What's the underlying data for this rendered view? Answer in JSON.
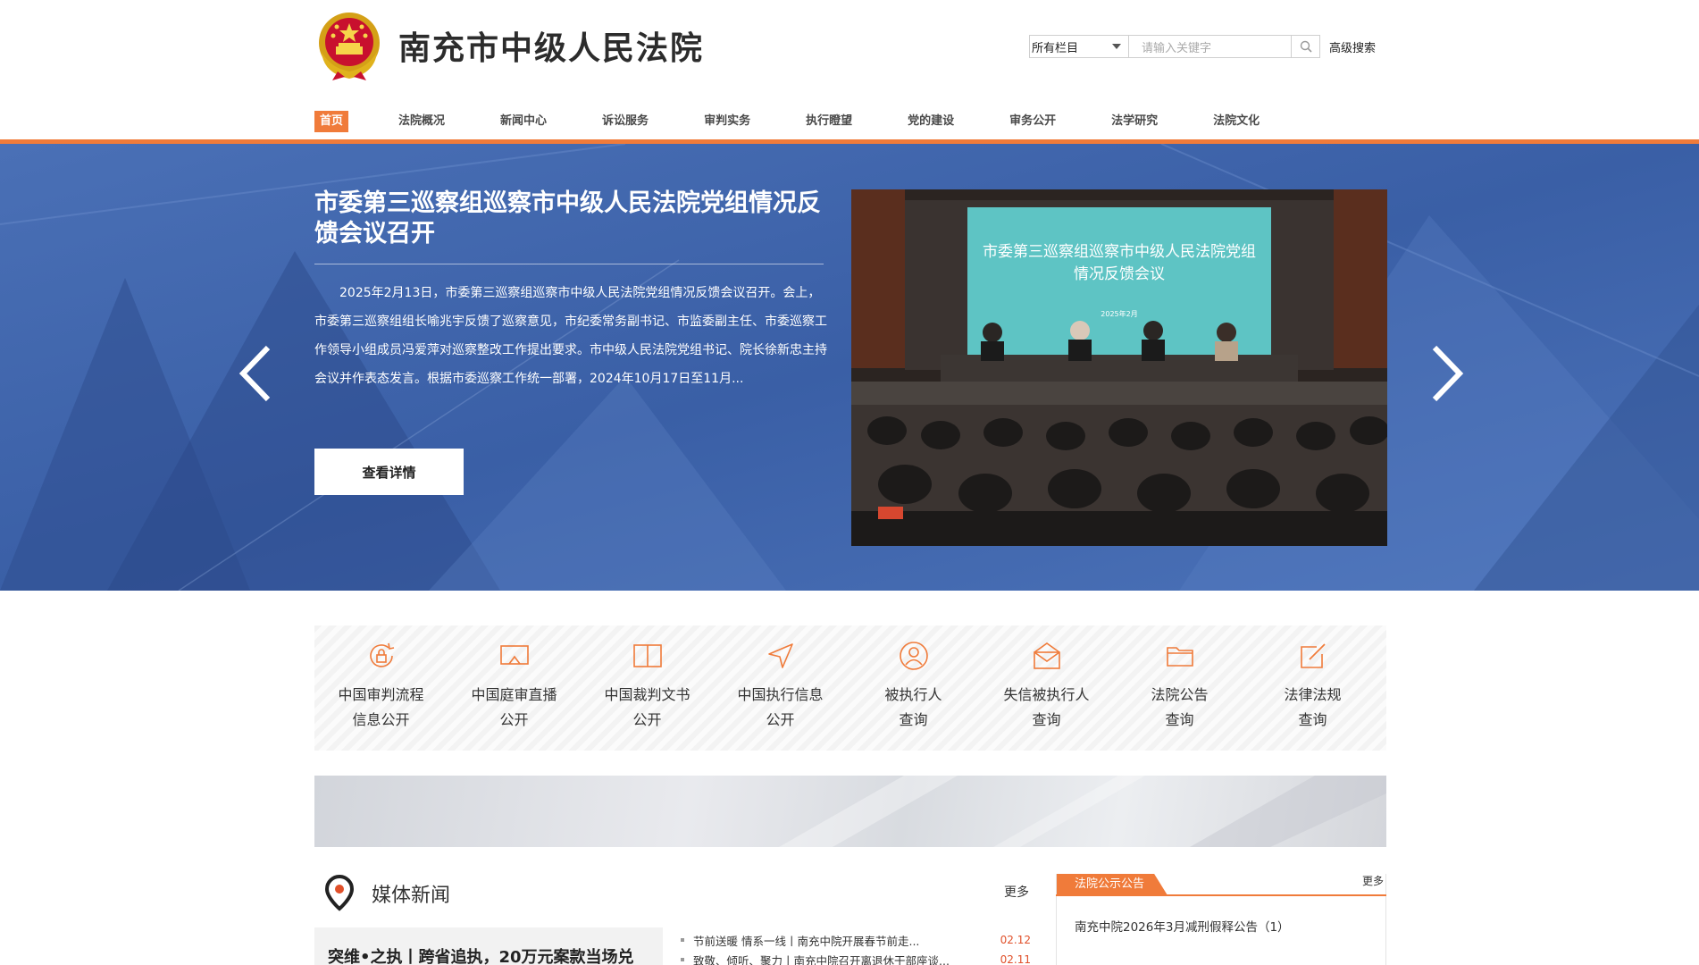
{
  "site": {
    "title": "南充市中级人民法院"
  },
  "search": {
    "scope_value": "所有栏目",
    "placeholder": "请输入关键字",
    "advanced_label": "高级搜索"
  },
  "nav": {
    "items": [
      {
        "label": "首页",
        "active": true
      },
      {
        "label": "法院概况"
      },
      {
        "label": "新闻中心"
      },
      {
        "label": "诉讼服务"
      },
      {
        "label": "审判实务"
      },
      {
        "label": "执行瞪望"
      },
      {
        "label": "党的建设"
      },
      {
        "label": "审务公开"
      },
      {
        "label": "法学研究"
      },
      {
        "label": "法院文化"
      }
    ]
  },
  "banner": {
    "title": "市委第三巡察组巡察市中级人民法院党组情况反馈会议召开",
    "summary": "2025年2月13日，市委第三巡察组巡察市中级人民法院党组情况反馈会议召开。会上，市委第三巡察组组长喻兆宇反馈了巡察意见，市纪委常务副书记、市监委副主任、市委巡察工作领导小组成员冯爱萍对巡察整改工作提出要求。市中级人民法院党组书记、院长徐新忠主持会议并作表态发言。根据市委巡察工作统一部署，2024年10月17日至11月...",
    "detail_button": "查看详情",
    "photo_screen_line1": "市委第三巡察组巡察市中级人民法院党组",
    "photo_screen_line2": "情况反馈会议",
    "photo_screen_date": "2025年2月"
  },
  "services": [
    {
      "line1": "中国审判流程",
      "line2": "信息公开",
      "icon": "lock-refresh-icon"
    },
    {
      "line1": "中国庭审直播",
      "line2": "公开",
      "icon": "screen-icon"
    },
    {
      "line1": "中国裁判文书",
      "line2": "公开",
      "icon": "book-icon"
    },
    {
      "line1": "中国执行信息",
      "line2": "公开",
      "icon": "send-icon"
    },
    {
      "line1": "被执行人",
      "line2": "查询",
      "icon": "person-icon"
    },
    {
      "line1": "失信被执行人",
      "line2": "查询",
      "icon": "envelope-icon"
    },
    {
      "line1": "法院公告",
      "line2": "查询",
      "icon": "folder-icon"
    },
    {
      "line1": "法律法规",
      "line2": "查询",
      "icon": "edit-icon"
    }
  ],
  "media": {
    "title": "媒体新闻",
    "more": "更多",
    "feature_title": "突维•之执丨跨省追执，20万元案款当场兑",
    "list": [
      {
        "text": "节前送暖 情系一线丨南充中院开展春节前走...",
        "date": "02.12"
      },
      {
        "text": "致敬、倾听、聚力丨南充中院召开离退休干部座谈...",
        "date": "02.11"
      }
    ]
  },
  "notice": {
    "tab": "法院公示公告",
    "more": "更多",
    "items": [
      "南充中院2026年3月减刑假释公告（1）"
    ]
  },
  "colors": {
    "accent": "#f07b3a",
    "banner_blue": "#3d63a8",
    "date_red": "#e0502a"
  }
}
